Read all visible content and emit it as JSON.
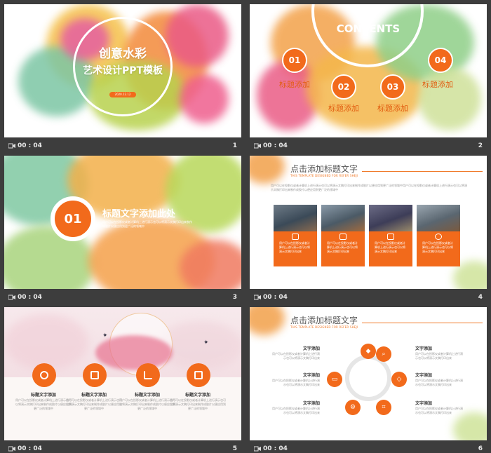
{
  "slides": [
    {
      "index": "1",
      "time": "00 : 04",
      "title_line1": "创意水彩",
      "title_line2": "艺术设计PPT模板",
      "date_badge": "2020.12.12"
    },
    {
      "index": "2",
      "time": "00 : 04",
      "contents_title": "CONTENTS",
      "items": [
        {
          "num": "01",
          "label": "标题添加"
        },
        {
          "num": "02",
          "label": "标题添加"
        },
        {
          "num": "03",
          "label": "标题添加"
        },
        {
          "num": "04",
          "label": "标题添加"
        }
      ]
    },
    {
      "index": "3",
      "time": "00 : 04",
      "num": "01",
      "heading": "标题文字添加此处",
      "body": "用户可以在投影仪或者计算机上进行演示也可以将演示文稿打印出来制作成胶片以便应用到更广泛的领域中"
    },
    {
      "index": "4",
      "time": "00 : 04",
      "heading": "点击添加标题文字",
      "subtitle": "THIS TEMPLATE DESIGNED FOR REFER SHEJI",
      "intro": "用户可以在投影仪或者计算机上进行演示也可以将演示文稿打印出来制作成胶片以便应用到更广泛的领域中用户可以在投影仪或者计算机上进行演示也可以将演示文稿打印出来制作成胶片以便应用到更广泛的领域中",
      "cards": [
        "用户可以在投影仪或者计算机上进行演示也可以将演示文稿打印出来",
        "用户可以在投影仪或者计算机上进行演示也可以将演示文稿打印出来",
        "用户可以在投影仪或者计算机上进行演示也可以将演示文稿打印出来",
        "用户可以在投影仪或者计算机上进行演示也可以将演示文稿打印出来"
      ]
    },
    {
      "index": "5",
      "time": "00 : 04",
      "features": [
        {
          "title": "标题文字添加",
          "text": "用户可以在投影仪或者计算机上进行演示也可以将演示文稿打印出来制作成胶片以便应用到更广泛的领域中"
        },
        {
          "title": "标题文字添加",
          "text": "用户可以在投影仪或者计算机上进行演示也可以将演示文稿打印出来制作成胶片以便应用到更广泛的领域中"
        },
        {
          "title": "标题文字添加",
          "text": "用户可以在投影仪或者计算机上进行演示也可以将演示文稿打印出来制作成胶片以便应用到更广泛的领域中"
        },
        {
          "title": "标题文字添加",
          "text": "用户可以在投影仪或者计算机上进行演示也可以将演示文稿打印出来制作成胶片以便应用到更广泛的领域中"
        }
      ]
    },
    {
      "index": "6",
      "time": "00 : 04",
      "heading": "点击添加标题文字",
      "subtitle": "THIS TEMPLATE DESIGNED FOR REFER SHEJI",
      "left_items": [
        {
          "title": "文字添加",
          "text": "用户可以在投影仪或者计算机上进行演示也可以将演示文稿打印出来"
        },
        {
          "title": "文字添加",
          "text": "用户可以在投影仪或者计算机上进行演示也可以将演示文稿打印出来"
        },
        {
          "title": "文字添加",
          "text": "用户可以在投影仪或者计算机上进行演示也可以将演示文稿打印出来"
        }
      ],
      "right_items": [
        {
          "title": "文字添加",
          "text": "用户可以在投影仪或者计算机上进行演示也可以将演示文稿打印出来"
        },
        {
          "title": "文字添加",
          "text": "用户可以在投影仪或者计算机上进行演示也可以将演示文稿打印出来"
        },
        {
          "title": "文字添加",
          "text": "用户可以在投影仪或者计算机上进行演示也可以将演示文稿打印出来"
        }
      ]
    }
  ],
  "colors": {
    "accent": "#f26a1b",
    "background": "#3d3d3d"
  }
}
